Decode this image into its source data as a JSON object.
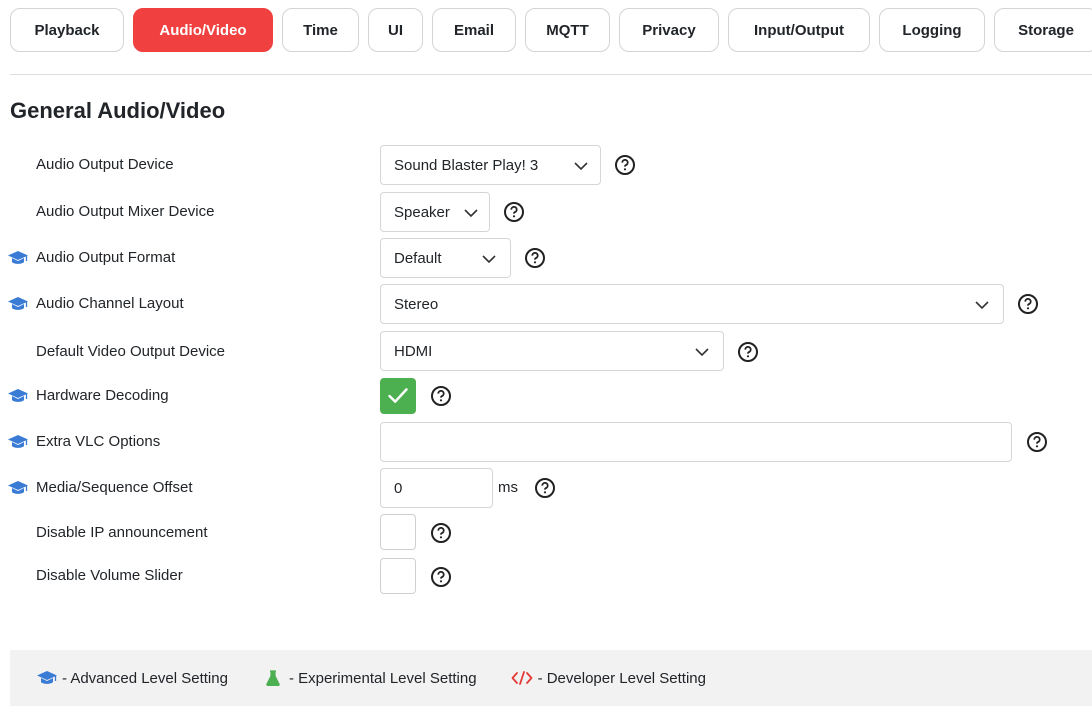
{
  "tabs": [
    {
      "label": "Playback",
      "active": false
    },
    {
      "label": "Audio/Video",
      "active": true
    },
    {
      "label": "Time",
      "active": false
    },
    {
      "label": "UI",
      "active": false
    },
    {
      "label": "Email",
      "active": false
    },
    {
      "label": "MQTT",
      "active": false
    },
    {
      "label": "Privacy",
      "active": false
    },
    {
      "label": "Input/Output",
      "active": false
    },
    {
      "label": "Logging",
      "active": false
    },
    {
      "label": "Storage",
      "active": false
    }
  ],
  "section_title": "General Audio/Video",
  "settings": {
    "audio_output_device": {
      "label": "Audio Output Device",
      "value": "Sound Blaster Play! 3",
      "level": "basic"
    },
    "audio_output_mixer": {
      "label": "Audio Output Mixer Device",
      "value": "Speaker",
      "level": "basic"
    },
    "audio_output_format": {
      "label": "Audio Output Format",
      "value": "Default",
      "level": "advanced"
    },
    "audio_channel_layout": {
      "label": "Audio Channel Layout",
      "value": "Stereo",
      "level": "advanced"
    },
    "default_video_output": {
      "label": "Default Video Output Device",
      "value": "HDMI",
      "level": "basic"
    },
    "hardware_decoding": {
      "label": "Hardware Decoding",
      "checked": true,
      "level": "advanced"
    },
    "extra_vlc_options": {
      "label": "Extra VLC Options",
      "value": "",
      "level": "advanced"
    },
    "media_sequence_offset": {
      "label": "Media/Sequence Offset",
      "value": "0",
      "unit": "ms",
      "level": "advanced"
    },
    "disable_ip_announcement": {
      "label": "Disable IP announcement",
      "checked": false,
      "level": "basic"
    },
    "disable_volume_slider": {
      "label": "Disable Volume Slider",
      "checked": false,
      "level": "basic"
    }
  },
  "legend": {
    "advanced": "- Advanced Level Setting",
    "experimental": "- Experimental Level Setting",
    "developer": "- Developer Level Setting"
  },
  "colors": {
    "active_tab": "#f04040",
    "check_on": "#4caf50",
    "advanced_icon": "#3a7bd5",
    "experimental_icon": "#4caf50",
    "developer_icon": "#e53935"
  },
  "icons": {
    "advanced": "graduation-cap-icon",
    "experimental": "flask-icon",
    "developer": "code-icon",
    "help": "question-circle-icon",
    "dropdown": "chevron-down-icon",
    "checkmark": "check-icon"
  }
}
